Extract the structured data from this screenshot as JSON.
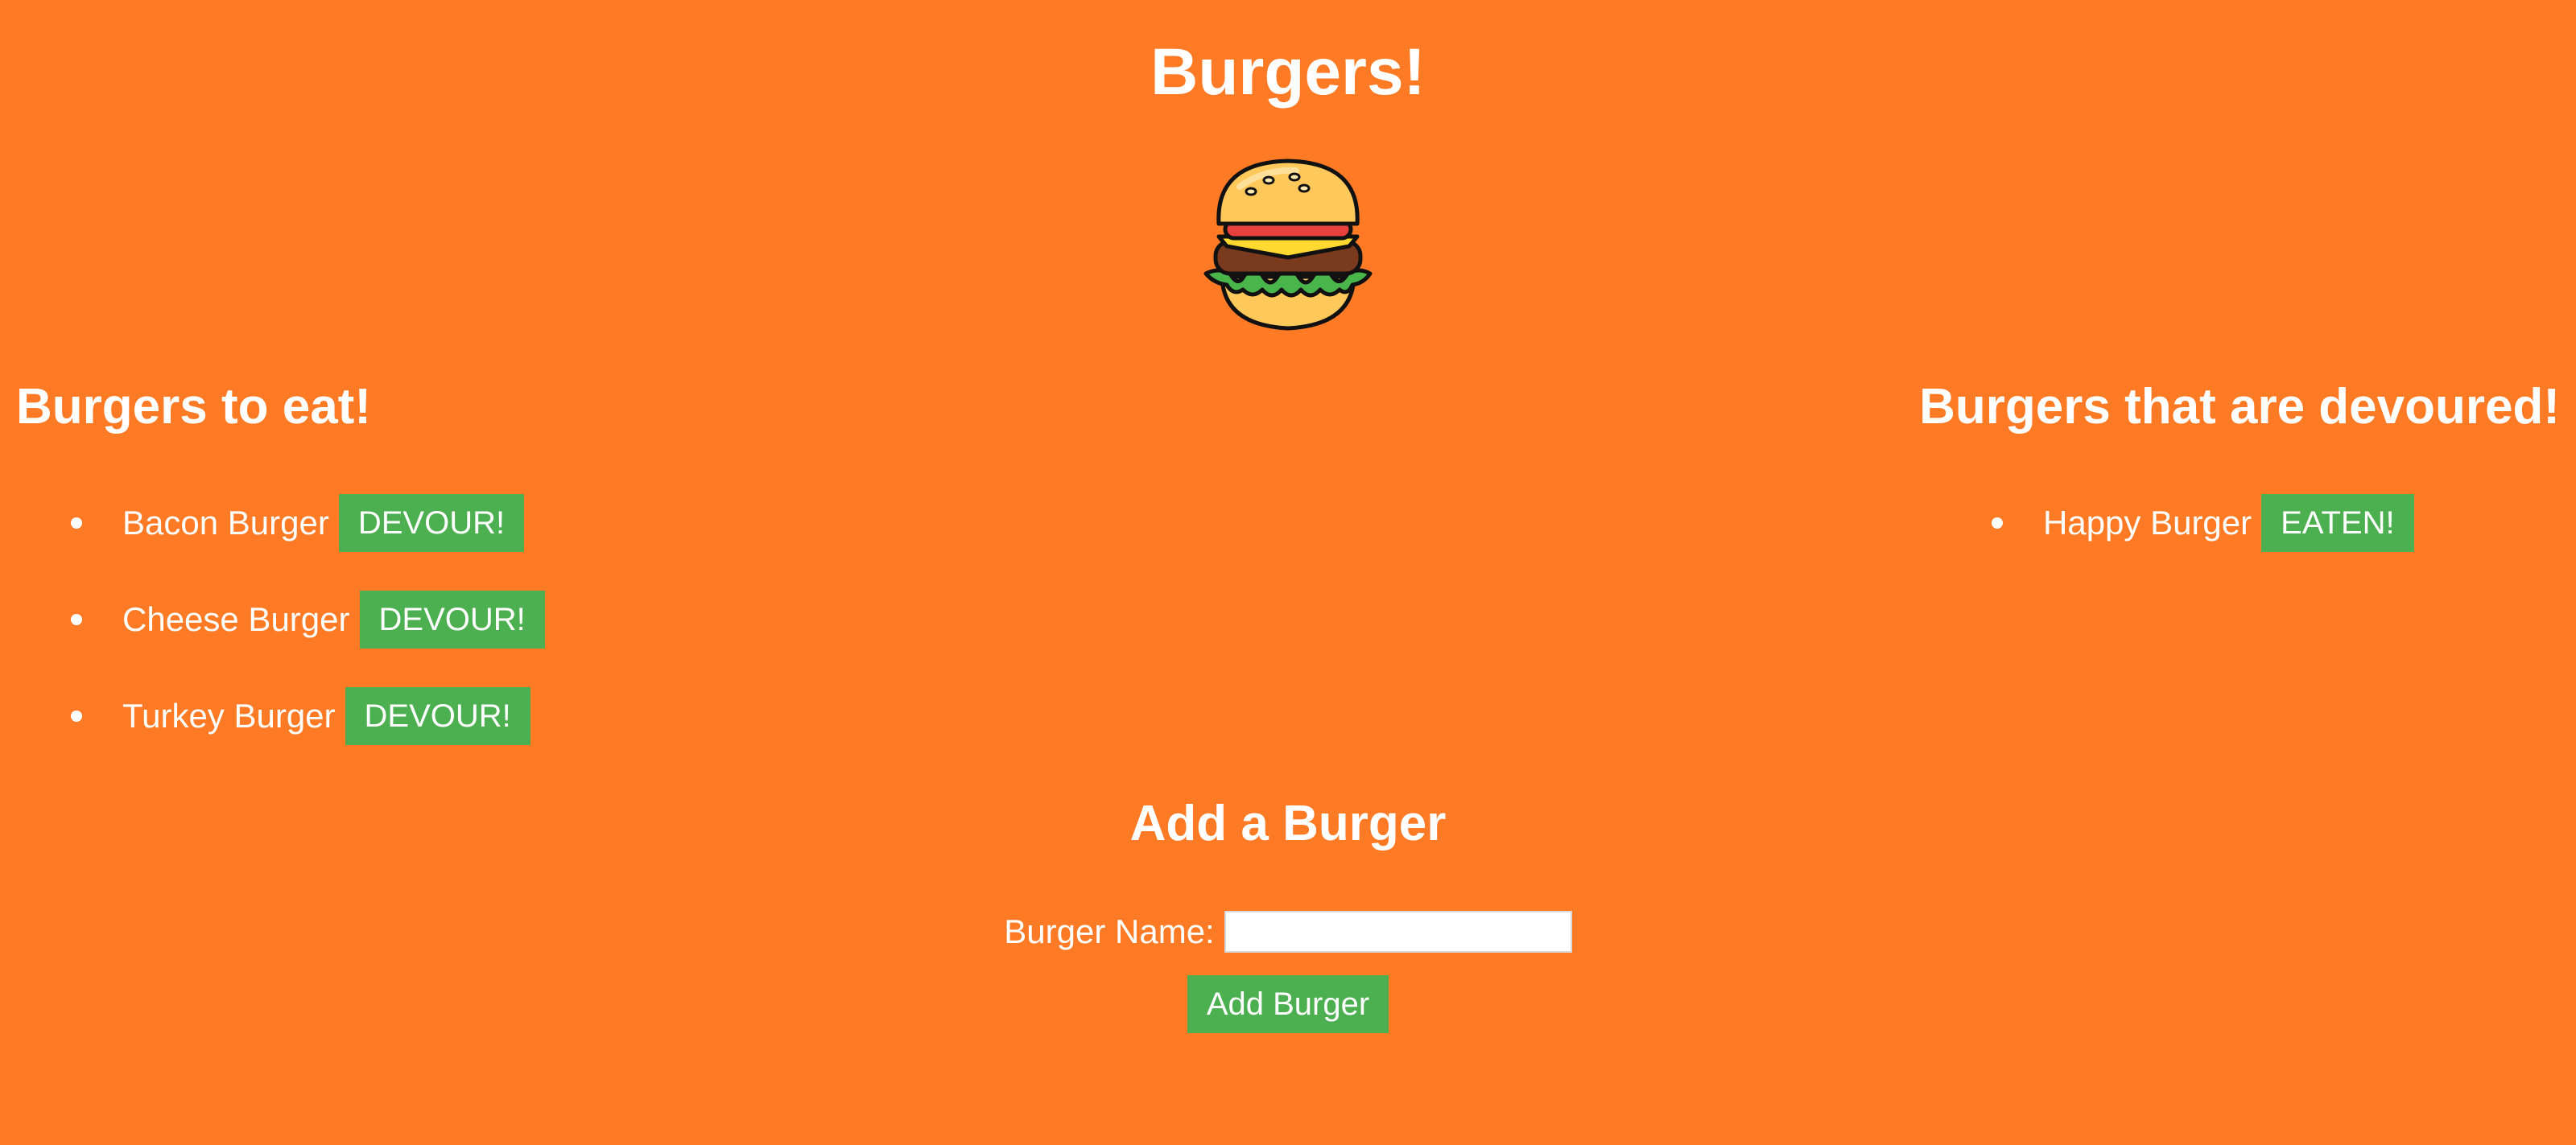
{
  "header": {
    "title": "Burgers!"
  },
  "logo": {
    "icon": "burger-icon"
  },
  "to_eat": {
    "heading": "Burgers to eat!",
    "items": [
      {
        "name": "Bacon Burger",
        "button": "DEVOUR!"
      },
      {
        "name": "Cheese Burger",
        "button": "DEVOUR!"
      },
      {
        "name": "Turkey Burger",
        "button": "DEVOUR!"
      }
    ]
  },
  "devoured": {
    "heading": "Burgers that are devoured!",
    "items": [
      {
        "name": "Happy Burger",
        "button": "EATEN!"
      }
    ]
  },
  "add_form": {
    "heading": "Add a Burger",
    "label": "Burger Name:",
    "input_value": "",
    "submit_label": "Add Burger"
  },
  "colors": {
    "background": "#ff7a25",
    "button": "#4caf50",
    "text": "#ffffff"
  }
}
